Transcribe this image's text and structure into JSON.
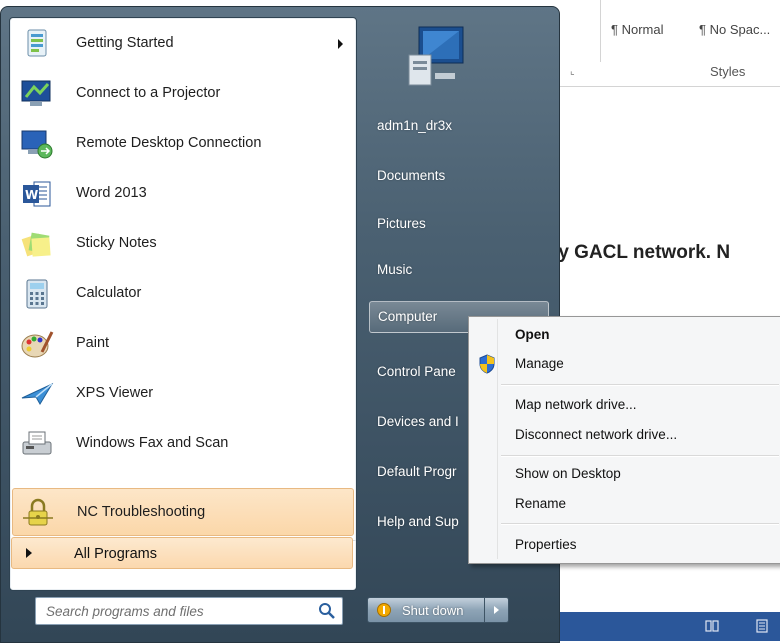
{
  "word": {
    "styles": [
      "¶ Normal",
      "¶ No Spac..."
    ],
    "styles_group_label": "Styles",
    "launcher_glyph": "⌞",
    "document_text": "ty GACL network. N",
    "statusbar_icons": [
      "read-mode-icon",
      "print-layout-icon"
    ]
  },
  "start_menu": {
    "programs": [
      {
        "label": "Getting Started",
        "icon": "getting-started-icon",
        "has_submenu": true
      },
      {
        "label": "Connect to a Projector",
        "icon": "projector-icon"
      },
      {
        "label": "Remote Desktop Connection",
        "icon": "remote-desktop-icon"
      },
      {
        "label": "Word 2013",
        "icon": "word-icon"
      },
      {
        "label": "Sticky Notes",
        "icon": "sticky-notes-icon"
      },
      {
        "label": "Calculator",
        "icon": "calculator-icon"
      },
      {
        "label": "Paint",
        "icon": "paint-icon"
      },
      {
        "label": "XPS Viewer",
        "icon": "xps-viewer-icon"
      },
      {
        "label": "Windows Fax and Scan",
        "icon": "fax-scan-icon"
      },
      {
        "label": "NC Troubleshooting",
        "icon": "lock-icon",
        "highlighted": true
      }
    ],
    "all_programs_label": "All Programs",
    "search": {
      "placeholder": "Search programs and files"
    },
    "right_items": [
      {
        "label": "adm1n_dr3x"
      },
      {
        "label": "Documents"
      },
      {
        "label": "Pictures"
      },
      {
        "label": "Music"
      },
      {
        "label": "Computer",
        "active": true
      },
      {
        "label": "Control Pane"
      },
      {
        "label": "Devices and I"
      },
      {
        "label": "Default Progr"
      },
      {
        "label": "Help and Sup"
      }
    ],
    "shutdown_label": "Shut down",
    "colors": {
      "highlight": "#fbd7a9",
      "pane": "#4b6172"
    }
  },
  "context_menu": {
    "items": [
      {
        "label": "Open",
        "bold": true
      },
      {
        "label": "Manage",
        "icon": "uac-shield-icon"
      },
      {
        "label": "Map network drive..."
      },
      {
        "label": "Disconnect network drive..."
      },
      {
        "label": "Show on Desktop"
      },
      {
        "label": "Rename"
      },
      {
        "label": "Properties"
      }
    ]
  }
}
